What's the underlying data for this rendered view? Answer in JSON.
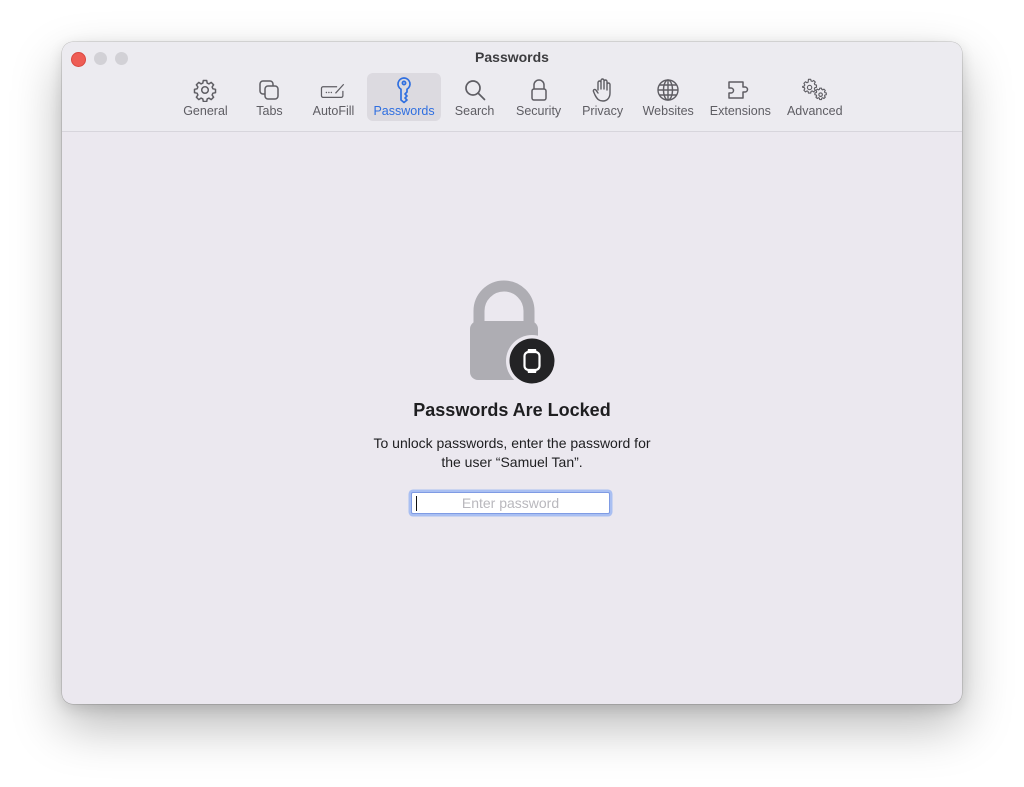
{
  "window": {
    "title": "Passwords",
    "traffic_lights": [
      "close",
      "minimize",
      "zoom"
    ]
  },
  "toolbar": {
    "active": "passwords",
    "accent_color": "#2f6fe0",
    "items": [
      {
        "id": "general",
        "label": "General",
        "icon": "gear-icon"
      },
      {
        "id": "tabs",
        "label": "Tabs",
        "icon": "tabs-icon"
      },
      {
        "id": "autofill",
        "label": "AutoFill",
        "icon": "autofill-icon"
      },
      {
        "id": "passwords",
        "label": "Passwords",
        "icon": "key-icon"
      },
      {
        "id": "search",
        "label": "Search",
        "icon": "search-icon"
      },
      {
        "id": "security",
        "label": "Security",
        "icon": "lock-icon"
      },
      {
        "id": "privacy",
        "label": "Privacy",
        "icon": "hand-icon"
      },
      {
        "id": "websites",
        "label": "Websites",
        "icon": "globe-icon"
      },
      {
        "id": "extensions",
        "label": "Extensions",
        "icon": "puzzle-icon"
      },
      {
        "id": "advanced",
        "label": "Advanced",
        "icon": "gears-icon"
      }
    ]
  },
  "locked": {
    "heading": "Passwords Are Locked",
    "description_line1": "To unlock passwords, enter the password for",
    "description_line2": "the user “Samuel Tan”.",
    "password_field": {
      "value": "",
      "placeholder": "Enter password"
    },
    "badge_icon": "apple-watch-icon"
  }
}
